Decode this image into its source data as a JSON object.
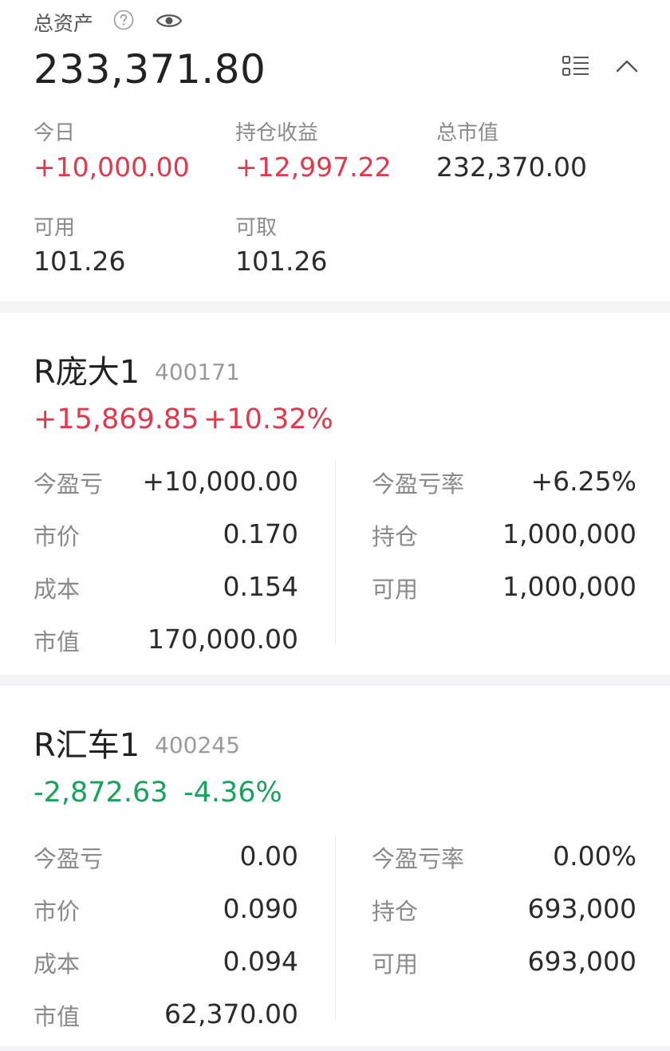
{
  "summary": {
    "total_label": "总资产",
    "total_value": "233,371.80",
    "icons": {
      "help": "question-circle-icon",
      "visibility": "eye-icon",
      "list": "list-view-icon",
      "collapse": "chevron-up-icon"
    },
    "today_label": "今日",
    "today_value": "+10,000.00",
    "holding_profit_label": "持仓收益",
    "holding_profit_value": "+12,997.22",
    "market_value_label": "总市值",
    "market_value_value": "232,370.00",
    "available_label": "可用",
    "available_value": "101.26",
    "withdrawable_label": "可取",
    "withdrawable_value": "101.26"
  },
  "colors": {
    "up": "#e0384c",
    "down": "#16a35c",
    "text": "#2b2b2b",
    "muted": "#8a8a8a",
    "bg": "#f4f4f6"
  },
  "positions": [
    {
      "name": "R庞大1",
      "code": "400171",
      "change_amount": "+15,869.85",
      "change_percent": "+10.32%",
      "direction": "up",
      "today_pl_label": "今盈亏",
      "today_pl": "+10,000.00",
      "price_label": "市价",
      "price": "0.170",
      "cost_label": "成本",
      "cost": "0.154",
      "mv_label": "市值",
      "market_value": "170,000.00",
      "today_pl_rate_label": "今盈亏率",
      "today_pl_rate": "+6.25%",
      "holding_label": "持仓",
      "holding": "1,000,000",
      "available_label": "可用",
      "available": "1,000,000"
    },
    {
      "name": "R汇车1",
      "code": "400245",
      "change_amount": "-2,872.63",
      "change_percent": "-4.36%",
      "direction": "down",
      "today_pl_label": "今盈亏",
      "today_pl": "0.00",
      "price_label": "市价",
      "price": "0.090",
      "cost_label": "成本",
      "cost": "0.094",
      "mv_label": "市值",
      "market_value": "62,370.00",
      "today_pl_rate_label": "今盈亏率",
      "today_pl_rate": "0.00%",
      "holding_label": "持仓",
      "holding": "693,000",
      "available_label": "可用",
      "available": "693,000"
    }
  ]
}
